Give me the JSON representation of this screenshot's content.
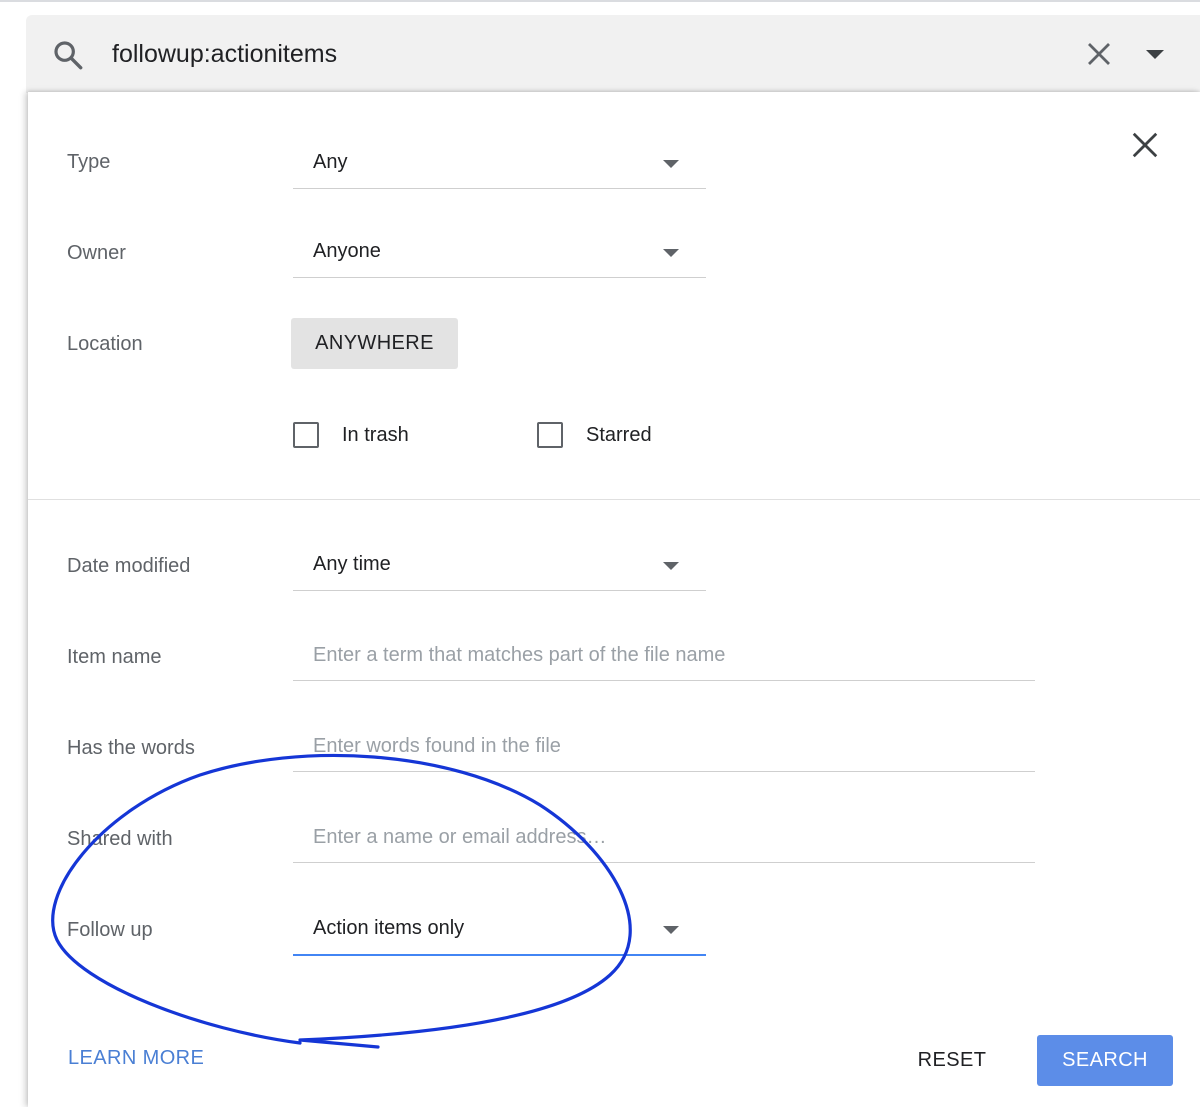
{
  "search": {
    "query": "followup:actionitems",
    "icon": "search-icon",
    "clear_icon": "close-icon",
    "options_icon": "caret-down-icon"
  },
  "filters": {
    "type": {
      "label": "Type",
      "value": "Any"
    },
    "owner": {
      "label": "Owner",
      "value": "Anyone"
    },
    "location": {
      "label": "Location",
      "button": "ANYWHERE"
    },
    "in_trash": {
      "label": "In trash",
      "checked": false
    },
    "starred": {
      "label": "Starred",
      "checked": false
    },
    "date_modified": {
      "label": "Date modified",
      "value": "Any time"
    },
    "item_name": {
      "label": "Item name",
      "placeholder": "Enter a term that matches part of the file name"
    },
    "has_words": {
      "label": "Has the words",
      "placeholder": "Enter words found in the file"
    },
    "shared_with": {
      "label": "Shared with",
      "placeholder": "Enter a name or email address…"
    },
    "follow_up": {
      "label": "Follow up",
      "value": "Action items only"
    }
  },
  "actions": {
    "learn_more": "LEARN MORE",
    "reset": "RESET",
    "search": "SEARCH"
  },
  "colors": {
    "accent": "#4285f4",
    "search_button": "#5c8de8",
    "link": "#4a7fd4",
    "annotation_ink": "#1536d6"
  }
}
